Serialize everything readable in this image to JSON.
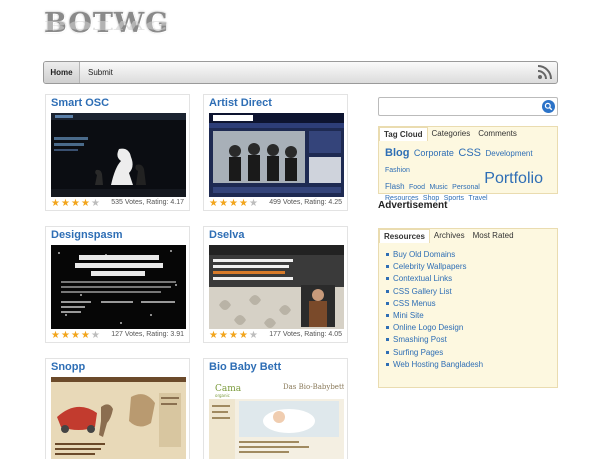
{
  "brand": {
    "logo_text": "BOTWG"
  },
  "nav": {
    "items": [
      "Home",
      "Submit"
    ],
    "rss_icon": "rss-icon"
  },
  "cards": [
    {
      "title": "Smart OSC",
      "votes": "535 Votes, Rating: 4.17",
      "rating": 4.17
    },
    {
      "title": "Artist Direct",
      "votes": "499 Votes, Rating: 4.25",
      "rating": 4.25
    },
    {
      "title": "Designspasm",
      "votes": "127 Votes, Rating: 3.91",
      "rating": 3.91
    },
    {
      "title": "Dselva",
      "votes": "177 Votes, Rating: 4.05",
      "rating": 4.05
    },
    {
      "title": "Snopp",
      "votes": "",
      "rating": null
    },
    {
      "title": "Bio Baby Bett",
      "votes": "",
      "rating": null
    }
  ],
  "search": {
    "placeholder": "",
    "value": "",
    "button_icon": "search-icon"
  },
  "tag_widget": {
    "tabs": [
      "Tag Cloud",
      "Categories",
      "Comments"
    ],
    "active_tab": "Tag Cloud",
    "tags": [
      {
        "label": "Blog",
        "weight": 3
      },
      {
        "label": "Corporate",
        "weight": 2
      },
      {
        "label": "CSS",
        "weight": 3
      },
      {
        "label": "Development",
        "weight": 1
      },
      {
        "label": "Fashion",
        "weight": 0
      },
      {
        "label": "Portfolio",
        "weight": 5
      },
      {
        "label": "Flash",
        "weight": 1
      },
      {
        "label": "Food",
        "weight": 0
      },
      {
        "label": "Music",
        "weight": 0
      },
      {
        "label": "Personal",
        "weight": 0
      },
      {
        "label": "Resources",
        "weight": 0
      },
      {
        "label": "Shop",
        "weight": 0
      },
      {
        "label": "Sports",
        "weight": 0
      },
      {
        "label": "Travel",
        "weight": 0
      }
    ]
  },
  "advertisement": {
    "heading": "Advertisement"
  },
  "resources_widget": {
    "tabs": [
      "Resources",
      "Archives",
      "Most Rated"
    ],
    "active_tab": "Resources",
    "links": [
      "Buy Old Domains",
      "Celebrity Wallpapers",
      "Contextual Links",
      "CSS Gallery List",
      "CSS Menus",
      "Mini Site",
      "Online Logo Design",
      "Smashing Post",
      "Surfing Pages",
      "Web Hosting Bangladesh"
    ]
  },
  "colors": {
    "link": "#2e6eb5",
    "widget_bg": "#fdf8e0",
    "star": "#f2a51c"
  }
}
